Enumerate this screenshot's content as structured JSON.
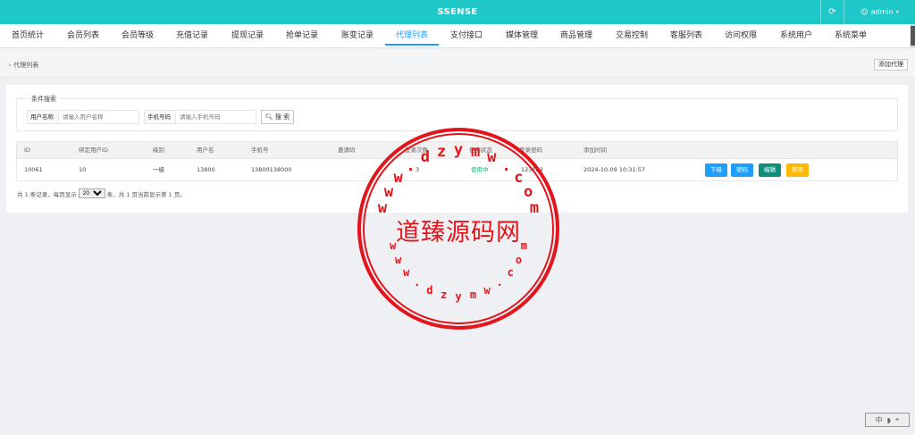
{
  "header": {
    "brand": "SSENSE",
    "refresh_icon": "refresh-icon",
    "user_icon": "user-icon",
    "user_name": "admin",
    "accent_color": "#1ec8c8"
  },
  "nav": {
    "items": [
      {
        "label": "首页统计"
      },
      {
        "label": "会员列表"
      },
      {
        "label": "会员等级"
      },
      {
        "label": "充值记录"
      },
      {
        "label": "提现记录"
      },
      {
        "label": "抢单记录"
      },
      {
        "label": "账变记录"
      },
      {
        "label": "代理列表",
        "active": true
      },
      {
        "label": "支付接口"
      },
      {
        "label": "媒体管理"
      },
      {
        "label": "商品管理"
      },
      {
        "label": "交易控制"
      },
      {
        "label": "客服列表"
      },
      {
        "label": "访问权限"
      },
      {
        "label": "系统用户"
      },
      {
        "label": "系统菜单"
      }
    ],
    "active_color": "#1e9fff"
  },
  "breadcrumb": {
    "label": "代理列表",
    "add_button": "添加代理"
  },
  "search": {
    "legend": "条件搜索",
    "username_label": "用户名称",
    "username_placeholder": "请输入用户名称",
    "phone_label": "手机号码",
    "phone_placeholder": "请输入手机号码",
    "search_button": "搜 索"
  },
  "table": {
    "headers": [
      "ID",
      "绑定用户ID",
      "级别",
      "用户名",
      "手机号",
      "邀请码",
      "登录次数",
      "使用状态",
      "登录密码",
      "添加时间"
    ],
    "rows": [
      {
        "id": "10061",
        "bind_user_id": "10",
        "level": "一级",
        "username": "13800",
        "phone": "13800138000",
        "invite_code": "",
        "login_count": "3",
        "status": "使用中",
        "password": "123123",
        "created": "2024-10-09 10:31:57",
        "actions": [
          "下级",
          "密码",
          "编辑",
          "禁用"
        ]
      }
    ]
  },
  "pager": {
    "text_before": "共 1 条记录，每页显示",
    "page_size": "20",
    "text_after": "条，共 1 页当前显示第 1 页。"
  },
  "watermark": {
    "center_text": "道臻源码网",
    "top_arc": "www.dzymw.com",
    "bottom_arc": "www.dzymw.com",
    "color": "#e3141b"
  },
  "corner_widget": {
    "glyph_1": "中",
    "glyph_2": "◗",
    "glyph_3": "⌖"
  }
}
